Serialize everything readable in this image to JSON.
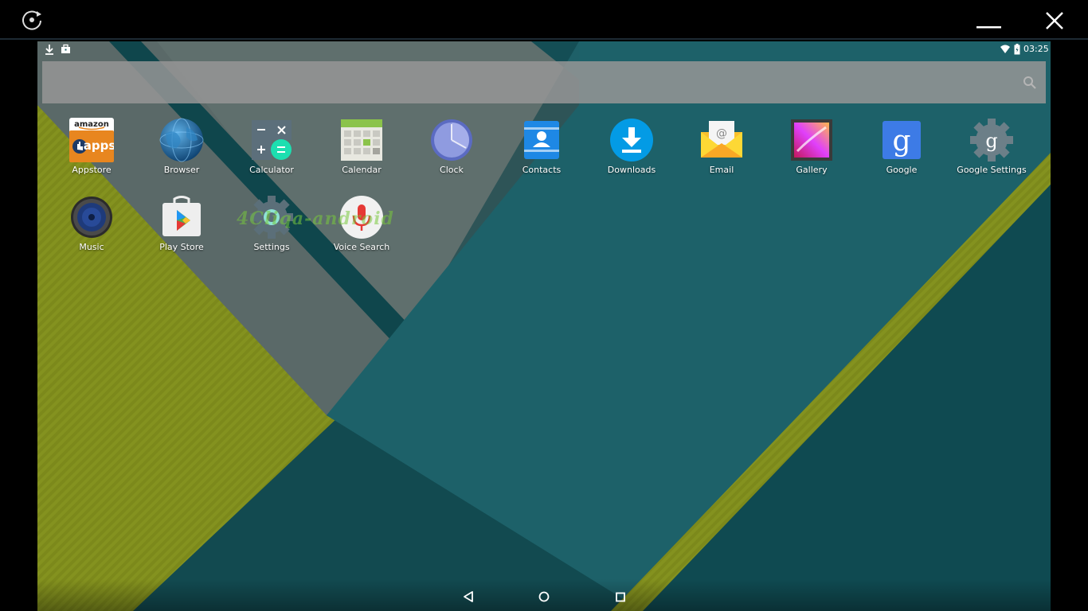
{
  "window": {
    "controls": [
      "rotate-icon",
      "minimize-icon",
      "close-icon"
    ]
  },
  "statusbar": {
    "left_icons": [
      "download-icon",
      "briefcase-icon"
    ],
    "right_icons": [
      "wifi-icon",
      "battery-icon"
    ],
    "time": "03:25"
  },
  "search": {
    "placeholder": "",
    "icon": "search-icon"
  },
  "apps_row1": [
    {
      "label": "Appstore",
      "icon": "amazon-appstore-icon"
    },
    {
      "label": "Browser",
      "icon": "globe-icon"
    },
    {
      "label": "Calculator",
      "icon": "calculator-icon"
    },
    {
      "label": "Calendar",
      "icon": "calendar-icon"
    },
    {
      "label": "Clock",
      "icon": "clock-icon"
    },
    {
      "label": "Contacts",
      "icon": "contacts-icon"
    },
    {
      "label": "Downloads",
      "icon": "download-icon"
    },
    {
      "label": "Email",
      "icon": "email-icon"
    },
    {
      "label": "Gallery",
      "icon": "gallery-icon"
    },
    {
      "label": "Google",
      "icon": "google-icon"
    },
    {
      "label": "Google Settings",
      "icon": "google-settings-icon"
    }
  ],
  "apps_row2": [
    {
      "label": "Music",
      "icon": "speaker-icon"
    },
    {
      "label": "Play Store",
      "icon": "play-store-icon"
    },
    {
      "label": "Settings",
      "icon": "gear-icon"
    },
    {
      "label": "Voice Search",
      "icon": "microphone-icon"
    }
  ],
  "watermark": "4Cliqa-android",
  "navbar": {
    "buttons": [
      "back-icon",
      "home-icon",
      "recents-icon"
    ]
  },
  "colors": {
    "wallpaper_teal": "#1d5f66",
    "wallpaper_dark_teal": "#12494f",
    "wallpaper_grey": "#5f6d6b",
    "wallpaper_olive": "#7d8a1a",
    "searchbar": "#969696"
  }
}
